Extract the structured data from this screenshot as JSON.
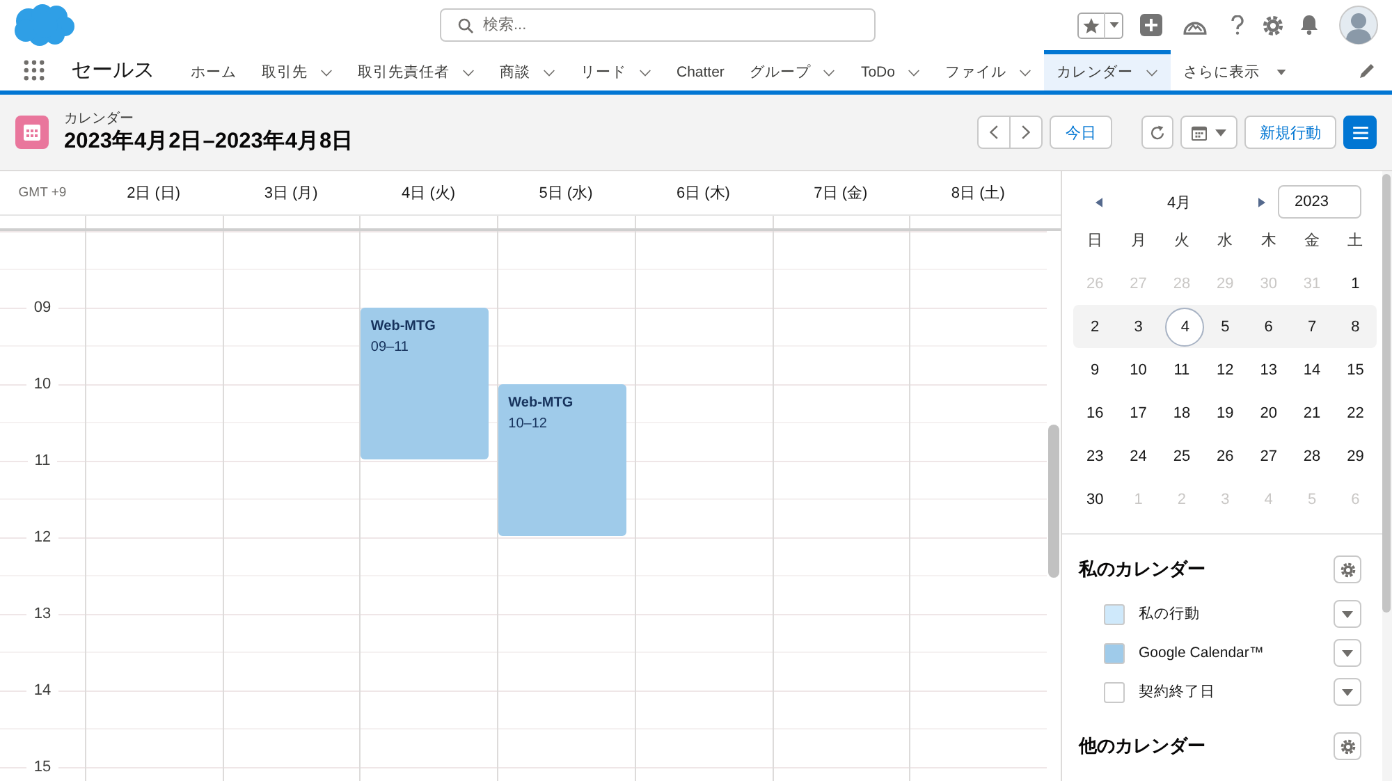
{
  "header": {
    "search": {
      "placeholder": "検索..."
    }
  },
  "nav": {
    "app_name": "セールス",
    "tabs": [
      {
        "label": "ホーム",
        "kind": "plain",
        "selected": false
      },
      {
        "label": "取引先",
        "kind": "menu",
        "selected": false
      },
      {
        "label": "取引先責任者",
        "kind": "menu",
        "selected": false
      },
      {
        "label": "商談",
        "kind": "menu",
        "selected": false
      },
      {
        "label": "リード",
        "kind": "menu",
        "selected": false
      },
      {
        "label": "Chatter",
        "kind": "plain",
        "selected": false
      },
      {
        "label": "グループ",
        "kind": "menu",
        "selected": false
      },
      {
        "label": "ToDo",
        "kind": "menu",
        "selected": false
      },
      {
        "label": "ファイル",
        "kind": "menu",
        "selected": false
      },
      {
        "label": "カレンダー",
        "kind": "menu",
        "selected": true
      },
      {
        "label": "さらに表示",
        "kind": "more",
        "selected": false
      }
    ]
  },
  "page_header": {
    "object_label": "カレンダー",
    "title": "2023年4月2日–2023年4月8日",
    "today_button": "今日",
    "new_event_button": "新規行動"
  },
  "week_view": {
    "timezone": "GMT +9",
    "days": [
      {
        "label": "2日 (日)"
      },
      {
        "label": "3日 (月)"
      },
      {
        "label": "4日 (火)",
        "events": [
          {
            "title": "Web-MTG",
            "time": "09–11"
          }
        ]
      },
      {
        "label": "5日 (水)",
        "events": [
          {
            "title": "Web-MTG",
            "time": "10–12"
          }
        ]
      },
      {
        "label": "6日 (木)"
      },
      {
        "label": "7日 (金)"
      },
      {
        "label": "8日 (土)"
      }
    ],
    "hours": [
      "09",
      "10",
      "11",
      "12",
      "13",
      "14",
      "15"
    ]
  },
  "mini_calendar": {
    "month": "4月",
    "year": "2023",
    "weekdays": [
      "日",
      "月",
      "火",
      "水",
      "木",
      "金",
      "土"
    ],
    "weeks": [
      {
        "selected": false,
        "days": [
          {
            "label": "26",
            "outside": true,
            "today": false
          },
          {
            "label": "27",
            "outside": true,
            "today": false
          },
          {
            "label": "28",
            "outside": true,
            "today": false
          },
          {
            "label": "29",
            "outside": true,
            "today": false
          },
          {
            "label": "30",
            "outside": true,
            "today": false
          },
          {
            "label": "31",
            "outside": true,
            "today": false
          },
          {
            "label": "1",
            "outside": false,
            "today": false
          }
        ]
      },
      {
        "selected": true,
        "days": [
          {
            "label": "2",
            "outside": false,
            "today": false
          },
          {
            "label": "3",
            "outside": false,
            "today": false
          },
          {
            "label": "4",
            "outside": false,
            "today": true
          },
          {
            "label": "5",
            "outside": false,
            "today": false
          },
          {
            "label": "6",
            "outside": false,
            "today": false
          },
          {
            "label": "7",
            "outside": false,
            "today": false
          },
          {
            "label": "8",
            "outside": false,
            "today": false
          }
        ]
      },
      {
        "selected": false,
        "days": [
          {
            "label": "9",
            "outside": false,
            "today": false
          },
          {
            "label": "10",
            "outside": false,
            "today": false
          },
          {
            "label": "11",
            "outside": false,
            "today": false
          },
          {
            "label": "12",
            "outside": false,
            "today": false
          },
          {
            "label": "13",
            "outside": false,
            "today": false
          },
          {
            "label": "14",
            "outside": false,
            "today": false
          },
          {
            "label": "15",
            "outside": false,
            "today": false
          }
        ]
      },
      {
        "selected": false,
        "days": [
          {
            "label": "16",
            "outside": false,
            "today": false
          },
          {
            "label": "17",
            "outside": false,
            "today": false
          },
          {
            "label": "18",
            "outside": false,
            "today": false
          },
          {
            "label": "19",
            "outside": false,
            "today": false
          },
          {
            "label": "20",
            "outside": false,
            "today": false
          },
          {
            "label": "21",
            "outside": false,
            "today": false
          },
          {
            "label": "22",
            "outside": false,
            "today": false
          }
        ]
      },
      {
        "selected": false,
        "days": [
          {
            "label": "23",
            "outside": false,
            "today": false
          },
          {
            "label": "24",
            "outside": false,
            "today": false
          },
          {
            "label": "25",
            "outside": false,
            "today": false
          },
          {
            "label": "26",
            "outside": false,
            "today": false
          },
          {
            "label": "27",
            "outside": false,
            "today": false
          },
          {
            "label": "28",
            "outside": false,
            "today": false
          },
          {
            "label": "29",
            "outside": false,
            "today": false
          }
        ]
      },
      {
        "selected": false,
        "days": [
          {
            "label": "30",
            "outside": false,
            "today": false
          },
          {
            "label": "1",
            "outside": true,
            "today": false
          },
          {
            "label": "2",
            "outside": true,
            "today": false
          },
          {
            "label": "3",
            "outside": true,
            "today": false
          },
          {
            "label": "4",
            "outside": true,
            "today": false
          },
          {
            "label": "5",
            "outside": true,
            "today": false
          },
          {
            "label": "6",
            "outside": true,
            "today": false
          }
        ]
      }
    ]
  },
  "my_calendars": {
    "title": "私のカレンダー",
    "items": [
      {
        "name": "私の行動",
        "color": "#cfe9fb"
      },
      {
        "name": "Google Calendar™",
        "color": "#9fcbea"
      },
      {
        "name": "契約終了日",
        "color": "#ffffff"
      }
    ]
  },
  "other_calendars": {
    "title": "他のカレンダー"
  }
}
